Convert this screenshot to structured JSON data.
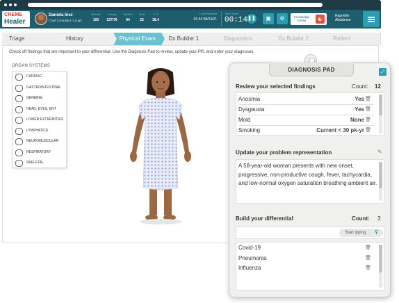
{
  "app": {
    "logo_top": "CREME",
    "logo_bottom": "Healer"
  },
  "patient": {
    "name": "Daniela Inez",
    "complaint": "Chief Complaint: Cough"
  },
  "vitals": [
    {
      "label": "HR/min",
      "value": "100"
    },
    {
      "label": "mmHg",
      "value": "127/76"
    },
    {
      "label": "SpO2%",
      "value": "94"
    },
    {
      "label": "br/M",
      "value": "22"
    },
    {
      "label": "T °C",
      "value": "38.4"
    }
  ],
  "clock": {
    "label": "Local Session",
    "value": "01:54 08/24/21"
  },
  "timer": {
    "label": "Time Spent",
    "value": "00:14"
  },
  "header_buttons": {
    "pause_icon": "pause-icon",
    "save_icon": "save-icon",
    "settings_icon": "gear-icon"
  },
  "knowledge_center": {
    "label": "Knowledge Center"
  },
  "user": {
    "name_line1": "Raja-Elle",
    "name_line2": "Abdalnour"
  },
  "tabs": [
    {
      "label": "Triage",
      "state": "normal"
    },
    {
      "label": "History",
      "state": "normal"
    },
    {
      "label": "Physical Exam",
      "state": "active"
    },
    {
      "label": "Dx Builder 1",
      "state": "normal"
    },
    {
      "label": "Diagnostics",
      "state": "disabled"
    },
    {
      "label": "Dx Builder 2",
      "state": "disabled"
    },
    {
      "label": "Reflect",
      "state": "disabled"
    }
  ],
  "instructions": "Check off findings that are important to your differential. Use the Diagnosis Pad to review, update your PR, and enter your diagnoses.",
  "organ_systems": {
    "title": "ORGAN SYSTEMS",
    "items": [
      "CARDIAC",
      "GASTROINTESTINAL",
      "GENERAL",
      "HEAD, EYES, ENT",
      "LOWER EXTREMITIES",
      "LYMPHATICS",
      "NEUROMUSCULAR",
      "RESPIRATORY",
      "SKELETAL"
    ]
  },
  "diagnosis_pad": {
    "title": "DIAGNOSIS PAD",
    "findings": {
      "title": "Review your selected findings",
      "count_label": "Count:",
      "count": "12",
      "items": [
        {
          "name": "Anosmia",
          "value": "Yes"
        },
        {
          "name": "Dysgeusia",
          "value": "Yes"
        },
        {
          "name": "Mold",
          "value": "None"
        },
        {
          "name": "Smoking",
          "value": "Current < 30 pk-yr"
        }
      ]
    },
    "problem_rep": {
      "title": "Update your problem representation",
      "text": "A 58-year-old woman presents with new onset, progressive, non-productive cough, fever, tachycardia, and low-normal oxygen saturation breathing ambient air."
    },
    "differential": {
      "title": "Build your differential",
      "count_label": "Count:",
      "count": "3",
      "search_placeholder": "Start typing",
      "items": [
        "Covid-19",
        "Pneumonia",
        "Influenza"
      ]
    }
  }
}
